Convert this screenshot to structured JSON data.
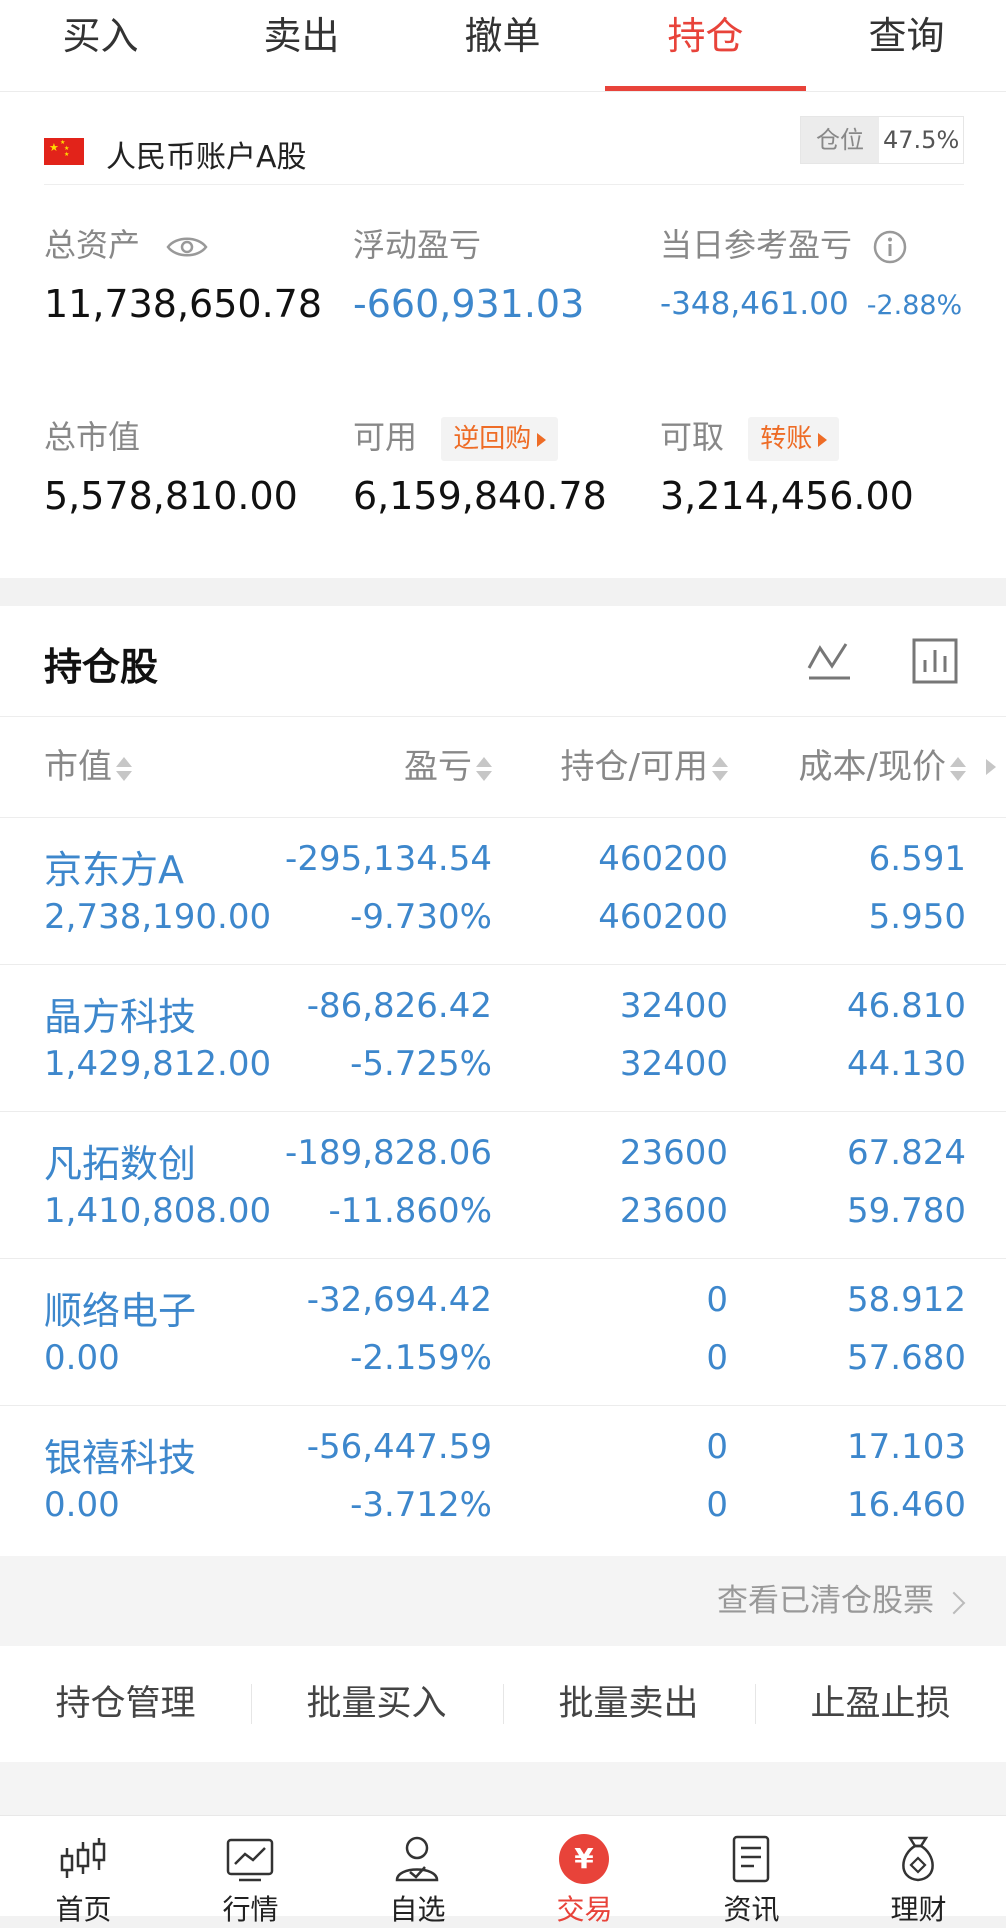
{
  "tabs": [
    "买入",
    "卖出",
    "撤单",
    "持仓",
    "查询"
  ],
  "active_tab": "持仓",
  "account": {
    "name": "人民币账户A股",
    "position_label": "仓位",
    "position_value": "47.5%"
  },
  "summary": {
    "total_assets_label": "总资产",
    "total_assets": "11,738,650.78",
    "floating_pl_label": "浮动盈亏",
    "floating_pl": "-660,931.03",
    "daily_pl_label": "当日参考盈亏",
    "daily_pl": "-348,461.00",
    "daily_pl_pct": "-2.88%",
    "market_value_label": "总市值",
    "market_value": "5,578,810.00",
    "available_label": "可用",
    "available": "6,159,840.78",
    "reverse_repo_label": "逆回购",
    "withdrawable_label": "可取",
    "withdrawable": "3,214,456.00",
    "transfer_label": "转账"
  },
  "holdings": {
    "title": "持仓股",
    "columns": [
      "市值",
      "盈亏",
      "持仓/可用",
      "成本/现价"
    ],
    "rows": [
      {
        "name": "京东方A",
        "market_value": "2,738,190.00",
        "pl": "-295,134.54",
        "pl_pct": "-9.730%",
        "position": "460200",
        "available": "460200",
        "cost": "6.591",
        "price": "5.950"
      },
      {
        "name": "晶方科技",
        "market_value": "1,429,812.00",
        "pl": "-86,826.42",
        "pl_pct": "-5.725%",
        "position": "32400",
        "available": "32400",
        "cost": "46.810",
        "price": "44.130"
      },
      {
        "name": "凡拓数创",
        "market_value": "1,410,808.00",
        "pl": "-189,828.06",
        "pl_pct": "-11.860%",
        "position": "23600",
        "available": "23600",
        "cost": "67.824",
        "price": "59.780"
      },
      {
        "name": "顺络电子",
        "market_value": "0.00",
        "pl": "-32,694.42",
        "pl_pct": "-2.159%",
        "position": "0",
        "available": "0",
        "cost": "58.912",
        "price": "57.680"
      },
      {
        "name": "银禧科技",
        "market_value": "0.00",
        "pl": "-56,447.59",
        "pl_pct": "-3.712%",
        "position": "0",
        "available": "0",
        "cost": "17.103",
        "price": "16.460"
      }
    ],
    "cleared_link": "查看已清仓股票"
  },
  "actions": [
    "持仓管理",
    "批量买入",
    "批量卖出",
    "止盈止损"
  ],
  "bottom_nav": [
    {
      "label": "首页",
      "icon": "candlestick-icon"
    },
    {
      "label": "行情",
      "icon": "chart-line-icon"
    },
    {
      "label": "自选",
      "icon": "user-check-icon"
    },
    {
      "label": "交易",
      "icon": "yen-icon"
    },
    {
      "label": "资讯",
      "icon": "document-icon"
    },
    {
      "label": "理财",
      "icon": "money-bag-icon"
    }
  ],
  "colors": {
    "accent": "#e8433a",
    "loss_blue": "#3d87cc",
    "tag_orange": "#ee6c26"
  }
}
